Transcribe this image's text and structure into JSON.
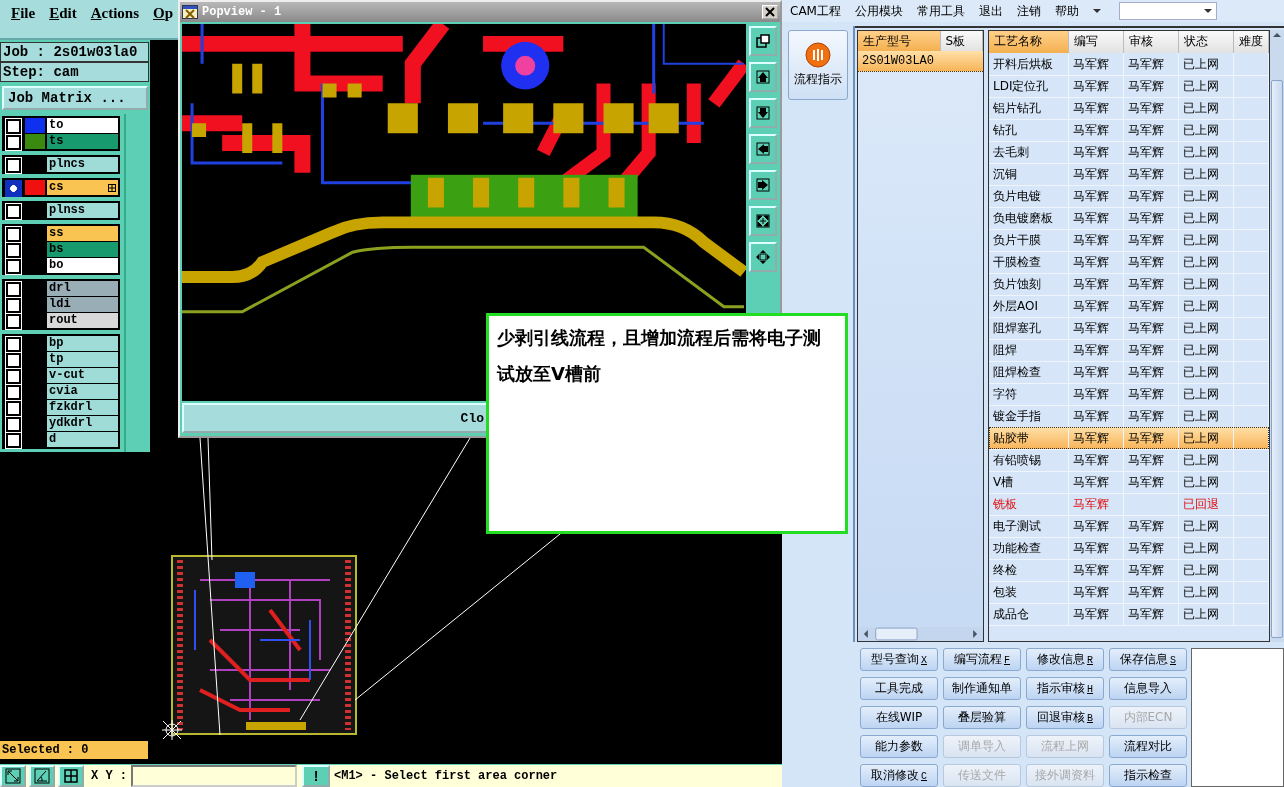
{
  "cam": {
    "menu": [
      "File",
      "Edit",
      "Actions",
      "Op"
    ],
    "job": "Job : 2s01w03la0",
    "step": "Step: cam",
    "job_matrix": "Job Matrix ...",
    "layer_groups": [
      [
        {
          "name": "to",
          "color": "#ffffff",
          "swatch": {
            "color": "#1030f0"
          },
          "selected": false
        },
        {
          "name": "ts",
          "color": "#179a6e",
          "swatch": {
            "color": "#3a8a10"
          },
          "selected": false
        }
      ],
      [
        {
          "name": "plncs",
          "color": "#9fdcd8",
          "selected": false
        }
      ],
      [
        {
          "name": "cs",
          "color": "#f9c452",
          "swatch": {
            "color": "#f01010"
          },
          "selected": true
        }
      ],
      [
        {
          "name": "plnss",
          "color": "#9fdcd8",
          "selected": false
        }
      ],
      [
        {
          "name": "ss",
          "color": "#f9c452",
          "selected": false
        },
        {
          "name": "bs",
          "color": "#179a6e",
          "selected": false
        },
        {
          "name": "bo",
          "color": "#ffffff",
          "selected": false
        }
      ],
      [
        {
          "name": "drl",
          "color": "#99adb6",
          "selected": false
        },
        {
          "name": "ldi",
          "color": "#99adb6",
          "selected": false
        },
        {
          "name": "rout",
          "color": "#d8d8d8",
          "selected": false
        }
      ],
      [
        {
          "name": "bp",
          "color": "#9fdcd8",
          "selected": false
        },
        {
          "name": "tp",
          "color": "#9fdcd8",
          "selected": false
        },
        {
          "name": "v-cut",
          "color": "#9fdcd8",
          "selected": false
        },
        {
          "name": "cvia",
          "color": "#9fdcd8",
          "selected": false
        },
        {
          "name": "fzkdrl",
          "color": "#9fdcd8",
          "selected": false
        },
        {
          "name": "ydkdrl",
          "color": "#9fdcd8",
          "selected": false
        },
        {
          "name": "d",
          "color": "#9fdcd8",
          "selected": false
        }
      ]
    ],
    "selected_count": "Selected : 0",
    "xy_label": "X Y :",
    "alert_button": "!",
    "prompt": "<M1> - Select first area corner"
  },
  "popview": {
    "title": "Popview - 1",
    "close_button": "Clo"
  },
  "callout": {
    "text": "少剥引线流程，且增加流程后需将电子测试放至V槽前"
  },
  "erp": {
    "menu": [
      "CAM工程",
      "公用模块",
      "常用工具",
      "退出",
      "注销",
      "帮助"
    ],
    "side_button": "流程指示",
    "list": {
      "columns": [
        {
          "label": "生产型号",
          "selected": true
        },
        {
          "label": "S板",
          "selected": false
        }
      ],
      "rows": [
        {
          "model": "2S01W03LA0",
          "selected": true
        }
      ]
    },
    "table": {
      "columns": [
        {
          "label": "工艺名称",
          "selected": true
        },
        {
          "label": "编写",
          "selected": false
        },
        {
          "label": "审核",
          "selected": false
        },
        {
          "label": "状态",
          "selected": false
        },
        {
          "label": "难度",
          "selected": false
        }
      ],
      "rows": [
        {
          "process": "开料后烘板",
          "writer": "马军辉",
          "reviewer": "马军辉",
          "status": "已上网",
          "rejected": false,
          "selected": false
        },
        {
          "process": "LDI定位孔",
          "writer": "马军辉",
          "reviewer": "马军辉",
          "status": "已上网",
          "rejected": false,
          "selected": false
        },
        {
          "process": "铝片钻孔",
          "writer": "马军辉",
          "reviewer": "马军辉",
          "status": "已上网",
          "rejected": false,
          "selected": false
        },
        {
          "process": "钻孔",
          "writer": "马军辉",
          "reviewer": "马军辉",
          "status": "已上网",
          "rejected": false,
          "selected": false
        },
        {
          "process": "去毛刺",
          "writer": "马军辉",
          "reviewer": "马军辉",
          "status": "已上网",
          "rejected": false,
          "selected": false
        },
        {
          "process": "沉铜",
          "writer": "马军辉",
          "reviewer": "马军辉",
          "status": "已上网",
          "rejected": false,
          "selected": false
        },
        {
          "process": "负片电镀",
          "writer": "马军辉",
          "reviewer": "马军辉",
          "status": "已上网",
          "rejected": false,
          "selected": false
        },
        {
          "process": "负电镀磨板",
          "writer": "马军辉",
          "reviewer": "马军辉",
          "status": "已上网",
          "rejected": false,
          "selected": false
        },
        {
          "process": "负片干膜",
          "writer": "马军辉",
          "reviewer": "马军辉",
          "status": "已上网",
          "rejected": false,
          "selected": false
        },
        {
          "process": "干膜检查",
          "writer": "马军辉",
          "reviewer": "马军辉",
          "status": "已上网",
          "rejected": false,
          "selected": false
        },
        {
          "process": "负片蚀刻",
          "writer": "马军辉",
          "reviewer": "马军辉",
          "status": "已上网",
          "rejected": false,
          "selected": false
        },
        {
          "process": "外层AOI",
          "writer": "马军辉",
          "reviewer": "马军辉",
          "status": "已上网",
          "rejected": false,
          "selected": false
        },
        {
          "process": "阻焊塞孔",
          "writer": "马军辉",
          "reviewer": "马军辉",
          "status": "已上网",
          "rejected": false,
          "selected": false
        },
        {
          "process": "阻焊",
          "writer": "马军辉",
          "reviewer": "马军辉",
          "status": "已上网",
          "rejected": false,
          "selected": false
        },
        {
          "process": "阻焊检查",
          "writer": "马军辉",
          "reviewer": "马军辉",
          "status": "已上网",
          "rejected": false,
          "selected": false
        },
        {
          "process": "字符",
          "writer": "马军辉",
          "reviewer": "马军辉",
          "status": "已上网",
          "rejected": false,
          "selected": false
        },
        {
          "process": "镀金手指",
          "writer": "马军辉",
          "reviewer": "马军辉",
          "status": "已上网",
          "rejected": false,
          "selected": false
        },
        {
          "process": "贴胶带",
          "writer": "马军辉",
          "reviewer": "马军辉",
          "status": "已上网",
          "rejected": false,
          "selected": true
        },
        {
          "process": "有铅喷锡",
          "writer": "马军辉",
          "reviewer": "马军辉",
          "status": "已上网",
          "rejected": false,
          "selected": false
        },
        {
          "process": "V槽",
          "writer": "马军辉",
          "reviewer": "马军辉",
          "status": "已上网",
          "rejected": false,
          "selected": false
        },
        {
          "process": "铣板",
          "writer": "马军辉",
          "status": "已回退",
          "rejected": true,
          "selected": false
        },
        {
          "process": "电子测试",
          "writer": "马军辉",
          "reviewer": "马军辉",
          "status": "已上网",
          "rejected": false,
          "selected": false
        },
        {
          "process": "功能检查",
          "writer": "马军辉",
          "reviewer": "马军辉",
          "status": "已上网",
          "rejected": false,
          "selected": false
        },
        {
          "process": "终检",
          "writer": "马军辉",
          "reviewer": "马军辉",
          "status": "已上网",
          "rejected": false,
          "selected": false
        },
        {
          "process": "包装",
          "writer": "马军辉",
          "reviewer": "马军辉",
          "status": "已上网",
          "rejected": false,
          "selected": false
        },
        {
          "process": "成品仓",
          "writer": "马军辉",
          "reviewer": "马军辉",
          "status": "已上网",
          "rejected": false,
          "selected": false
        }
      ]
    },
    "buttons": [
      {
        "label": "型号查询",
        "key": "X",
        "disabled": false
      },
      {
        "label": "编写流程",
        "key": "F",
        "disabled": false
      },
      {
        "label": "修改信息",
        "key": "R",
        "disabled": false
      },
      {
        "label": "保存信息",
        "key": "S",
        "disabled": false
      },
      {
        "label": "工具完成",
        "disabled": false
      },
      {
        "label": "制作通知单",
        "disabled": false
      },
      {
        "label": "指示审核",
        "key": "H",
        "disabled": false
      },
      {
        "label": "信息导入",
        "disabled": false
      },
      {
        "label": "在线WIP",
        "disabled": false
      },
      {
        "label": "叠层验算",
        "disabled": false
      },
      {
        "label": "回退审核",
        "key": "B",
        "disabled": false
      },
      {
        "label": "内部ECN",
        "disabled": true
      },
      {
        "label": "能力参数",
        "disabled": false
      },
      {
        "label": "调单导入",
        "disabled": true
      },
      {
        "label": "流程上网",
        "disabled": true
      },
      {
        "label": "流程对比",
        "disabled": false
      },
      {
        "label": "取消修改",
        "key": "C",
        "disabled": false
      },
      {
        "label": "传送文件",
        "disabled": true
      },
      {
        "label": "接外调资料",
        "disabled": true
      },
      {
        "label": "指示检查",
        "disabled": false
      }
    ]
  }
}
